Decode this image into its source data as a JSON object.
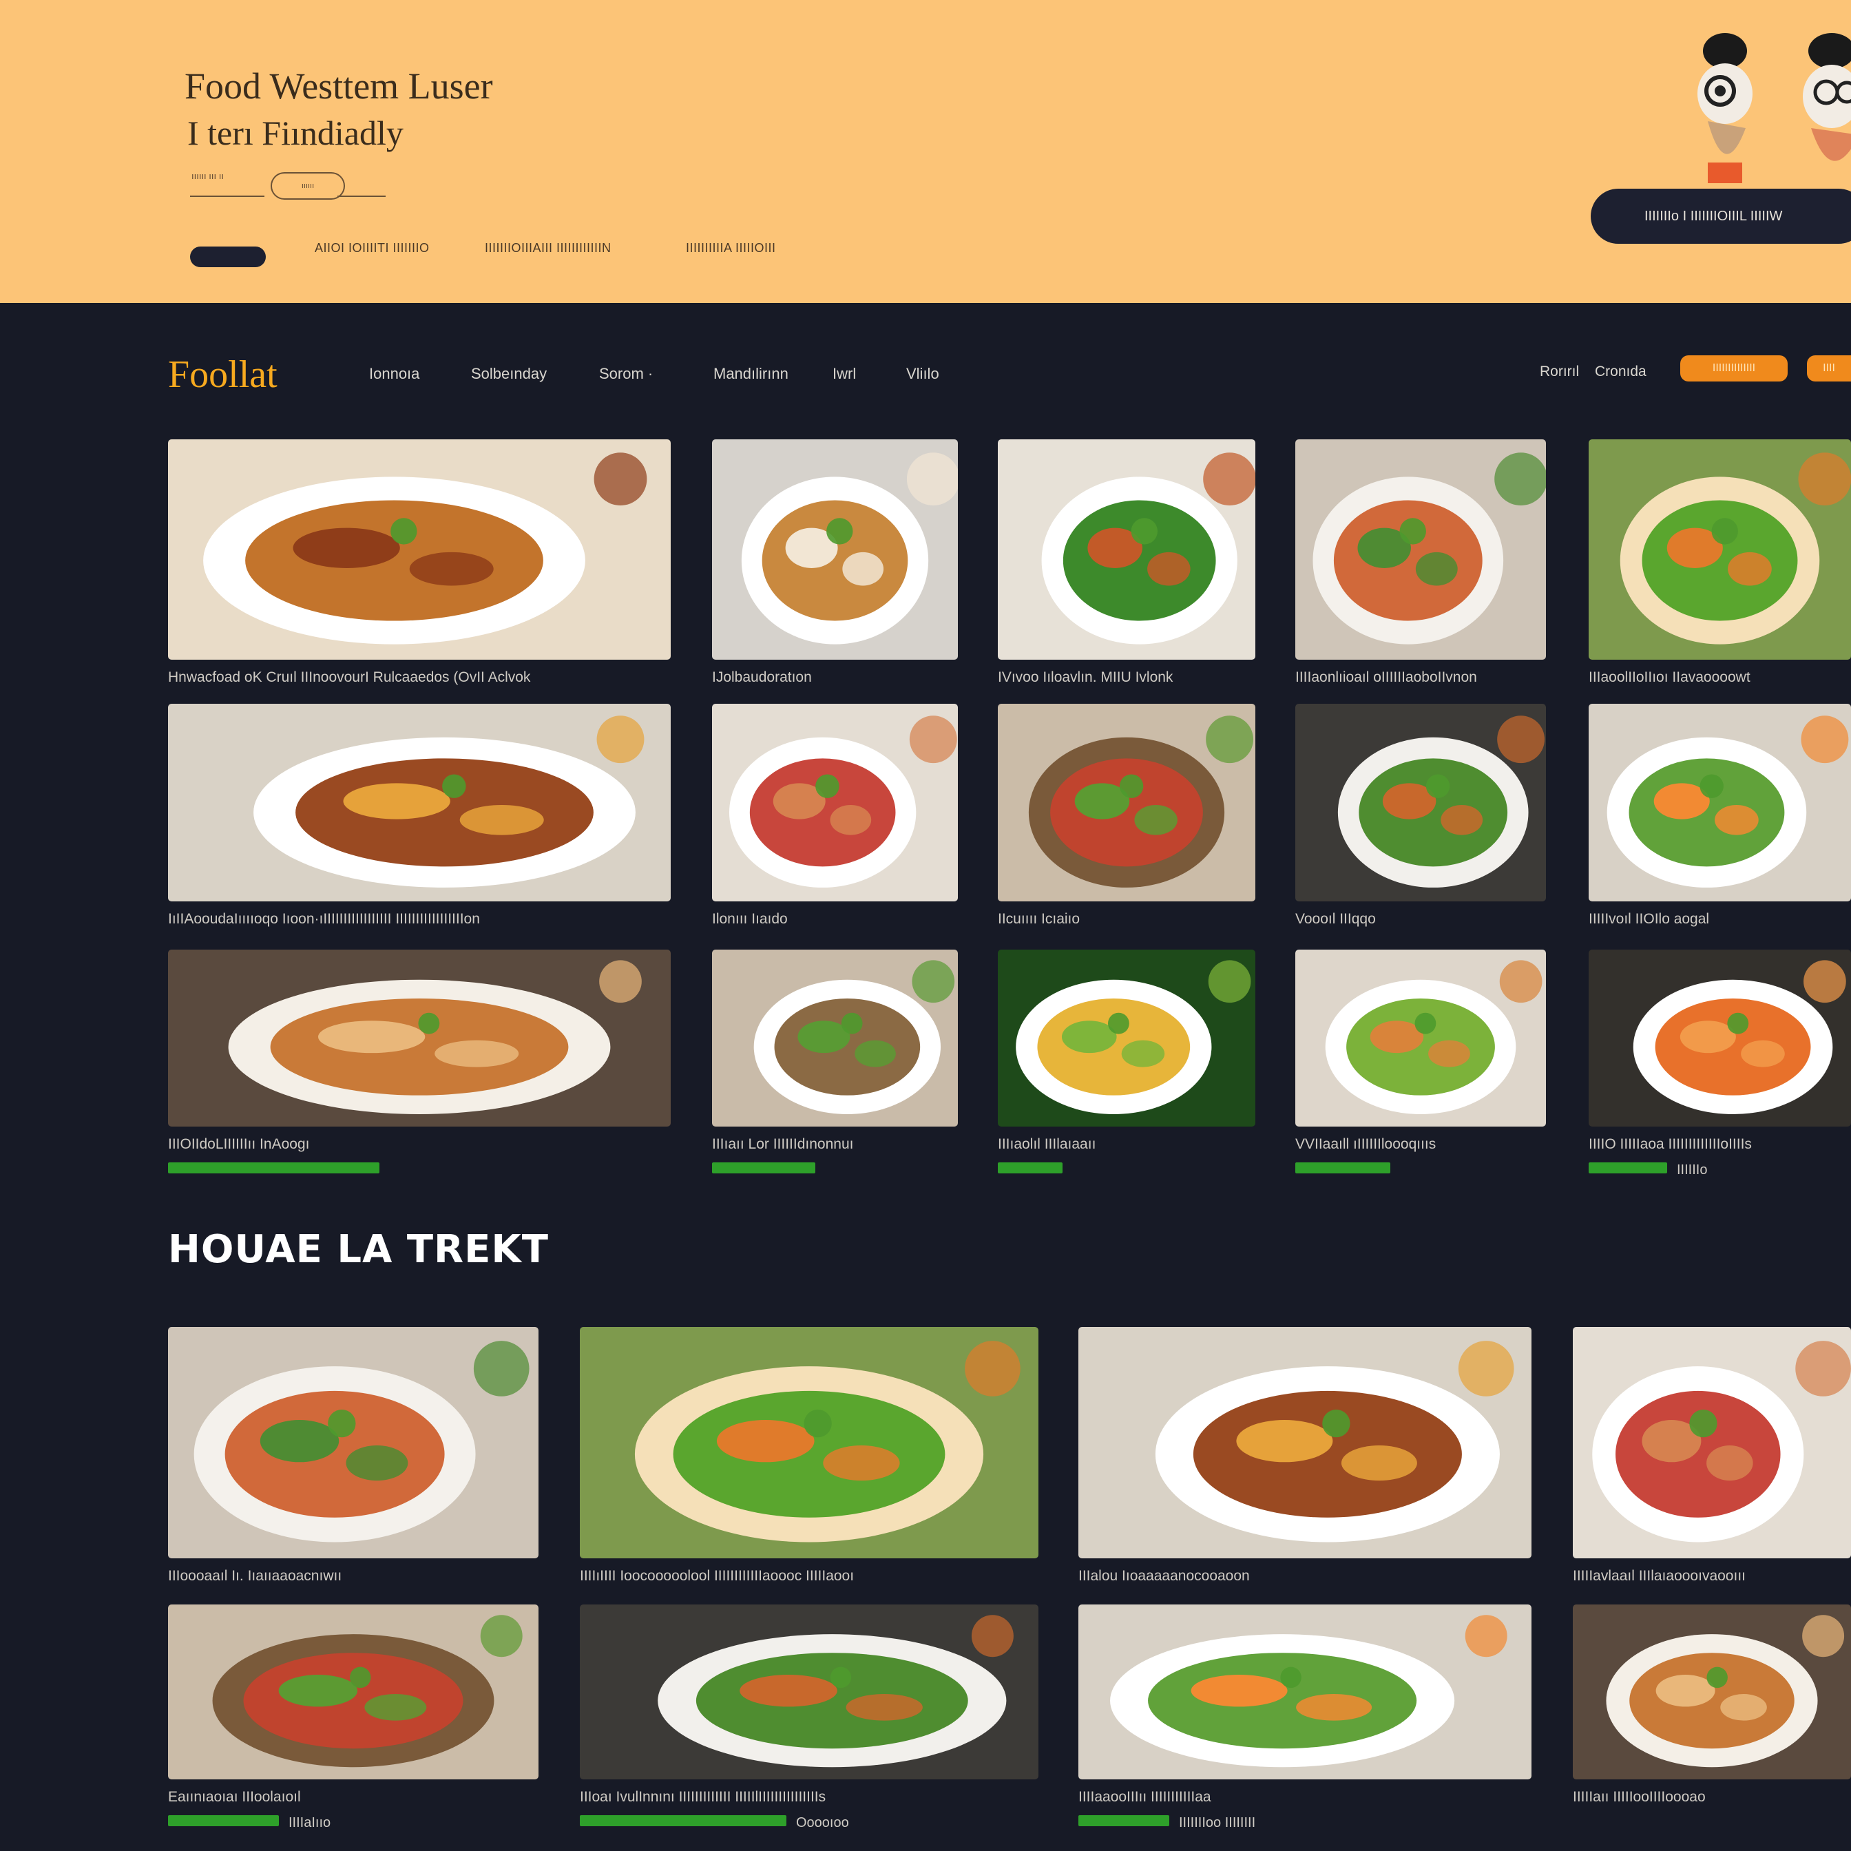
{
  "hero": {
    "title": "Food Westtem Luser",
    "subtitle": "I terı Fiındiadly",
    "small_label": "ıııııı ııı ıı",
    "chip_label": "ıııııı",
    "links": [
      "AIIOI IOIIIITI IIIIIIIO",
      "IIIIIIIOIIIAIII IIIIIIIIIIIIN",
      "IIIIIIIIIIA IIIIIOIII"
    ],
    "cta_label": "IIIIIIIo I IIIIIIIOIIIL IIIIIW"
  },
  "nav": {
    "logo": "Foollat",
    "items": [
      "Ionnoıa",
      "Solbeınday",
      "Sorom ·",
      "Mandılirınn",
      "Iwrl",
      "Vliılo"
    ],
    "right_links": [
      "Rorırıl",
      "Cronıda"
    ],
    "button1_label": "IIIIIIIIIIIIII",
    "button2_label": "IIII"
  },
  "grid_cards": [
    {
      "caption": "Hnwacfoad oK Cruıl IIInoovourI Rulcaaedos (OvII Aclvok"
    },
    {
      "caption": "IJolbaudoratıon"
    },
    {
      "caption": "IVıvoo Iıloavlın. MIIU Ivlonk"
    },
    {
      "caption": "IIIIaonlıioaıl oIIIIIIaoboIIvnon"
    },
    {
      "caption": "IIIaoolIIoIIıoı IIavaoooowt"
    },
    {
      "caption": "IıIIAooudaIııııoqo Iıoon·ıIIIIIIIIIIIIIIIII IIIIIIIIIIIIIIIIIon"
    },
    {
      "caption": "Ilonııı Iıaıdo"
    },
    {
      "caption": "IIcuıııı Icıaiıo"
    },
    {
      "caption": "Voooıl IIIqqo"
    },
    {
      "caption": "IIIIIvoıl IIOIlo aogal"
    },
    {
      "caption": "IIIOIIdoLIIIIIIıı InAoogı",
      "progress": 0.42
    },
    {
      "caption": "IIIıaıı Lor IIIIIIdınonnuı",
      "progress": 0.42
    },
    {
      "caption": "IIIıaolıl IIIlaıaaıı",
      "progress": 0.25
    },
    {
      "caption": "VVIIaaıll ıIIIIIIloooqıııs",
      "progress": 0.38
    },
    {
      "caption": "IIIIO IIIIIaoa IIIIIIIIIIIIIoIIIIs",
      "progress": 0.3,
      "sub": "IIIIIIo"
    }
  ],
  "section2": {
    "title": "HOUAE LA TREKT",
    "cards": [
      {
        "caption": "IIIoooaaıl Iı. Iıaııaaoacnıwıı"
      },
      {
        "caption": "IIIIıIIII Ioocooooolool IIIIIIIIIIIIaoooc IIIIIaooı"
      },
      {
        "caption": "IIIalou Iıoaaaaanocooaoon"
      },
      {
        "caption": "IIIIIavlaaıl IIIlaıaoooıvaooııı"
      },
      {
        "caption": "Eaıınıaoıaı IIIoolaıoıl",
        "progress": 0.3,
        "sub": "IIIIaIııo"
      },
      {
        "caption": "IIIoaı IvulInnını IIIIIIIIIIIII IIIIIlIIIIIIIIIIIIIIIs",
        "progress": 0.45,
        "sub": "Ooooıoo"
      },
      {
        "caption": "IIIIaaooIIIıı IIIIIIIIIIIaa",
        "progress": 0.2,
        "sub": "IIIIIIIoo IIIIIIII"
      },
      {
        "caption": "IIIIIaıı IIIIIooIIIIoooao"
      }
    ]
  },
  "colors": {
    "hero_bg": "#fcc477",
    "page_bg": "#171a26",
    "accent_orange": "#f08a1c",
    "progress_green": "#2ea02a"
  }
}
